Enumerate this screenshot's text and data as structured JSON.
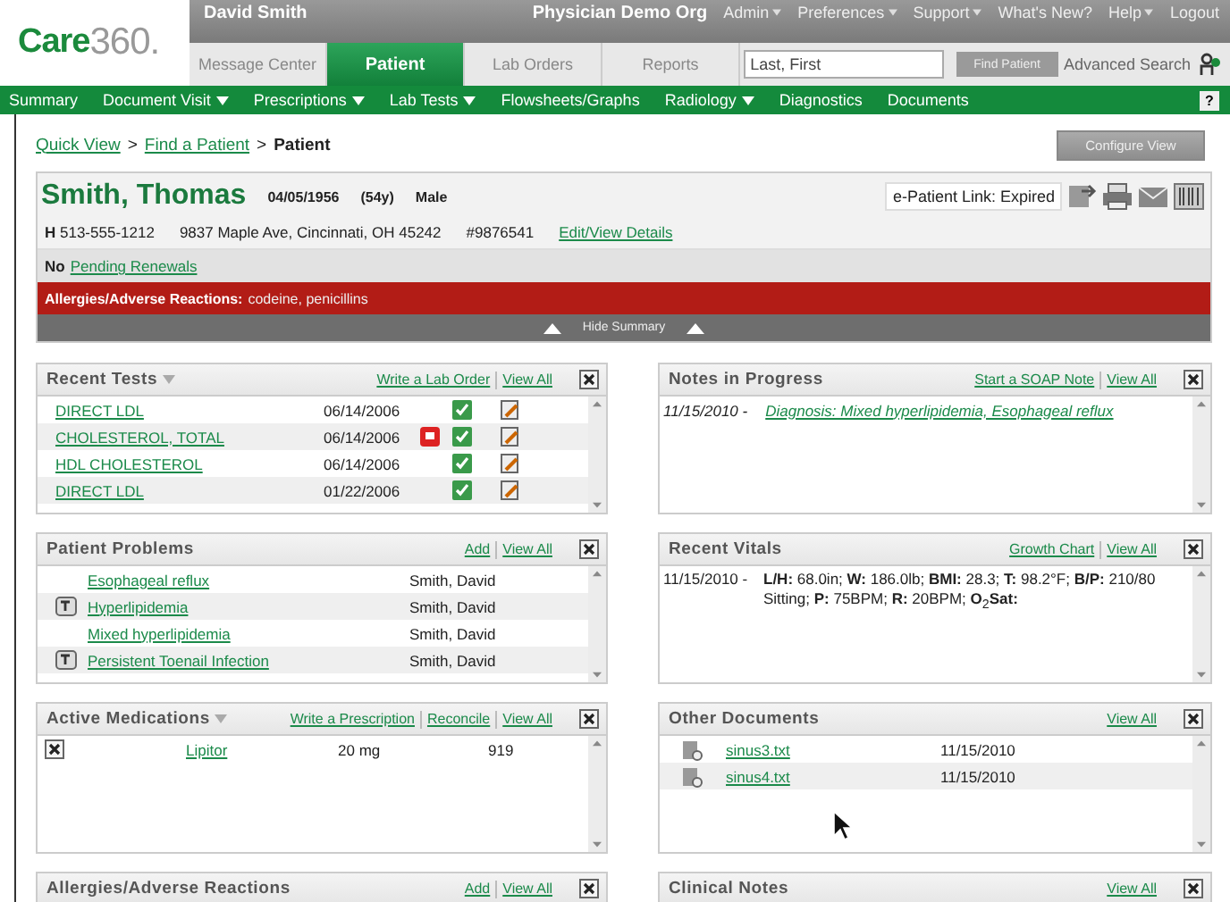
{
  "header": {
    "logo": {
      "brand": "Care",
      "suffix": "360."
    },
    "user": "David Smith",
    "org": "Physician Demo Org",
    "top_menu": [
      {
        "label": "Admin",
        "has_menu": true
      },
      {
        "label": "Preferences",
        "has_menu": true
      },
      {
        "label": "Support",
        "has_menu": true
      },
      {
        "label": "What's New?",
        "has_menu": false
      },
      {
        "label": "Help",
        "has_menu": true
      },
      {
        "label": "Logout",
        "has_menu": false
      }
    ],
    "tabs": [
      {
        "label": "Message Center",
        "selected": false
      },
      {
        "label": "Patient",
        "selected": true
      },
      {
        "label": "Lab Orders",
        "selected": false
      },
      {
        "label": "Reports",
        "selected": false
      }
    ],
    "search": {
      "placeholder": "Last, First",
      "button": "Find Patient",
      "advanced": "Advanced Search"
    }
  },
  "nav": [
    {
      "label": "Summary",
      "has_menu": false
    },
    {
      "label": "Document Visit",
      "has_menu": true
    },
    {
      "label": "Prescriptions",
      "has_menu": true
    },
    {
      "label": "Lab Tests",
      "has_menu": true
    },
    {
      "label": "Flowsheets/Graphs",
      "has_menu": false
    },
    {
      "label": "Radiology",
      "has_menu": true
    },
    {
      "label": "Diagnostics",
      "has_menu": false
    },
    {
      "label": "Documents",
      "has_menu": false
    }
  ],
  "nav_help": "?",
  "breadcrumb": [
    {
      "label": "Quick View",
      "link": true
    },
    {
      "label": "Find a Patient",
      "link": true
    },
    {
      "label": "Patient",
      "link": false
    }
  ],
  "breadcrumb_sep": ">",
  "configure_button": "Configure View",
  "patient": {
    "name": "Smith, Thomas",
    "dob": "04/05/1956",
    "age": "(54y)",
    "sex": "Male",
    "epatient_link": "e-Patient Link: Expired",
    "phone": "**H** 513-555-1212",
    "address": "9837 Maple Ave, Cincinnati, OH 45242",
    "id": "#9876541",
    "edit_link": "Edit/View Details",
    "renewals_prefix": "No",
    "renewals_link": "Pending Renewals",
    "allergies": "**Allergies/Adverse Reactions:** codeine, penicillins",
    "hide_summary": "Hide Summary"
  },
  "left_panels": [
    {
      "kind": "tests",
      "title": "Recent Tests",
      "has_menu": true,
      "links": [
        "Write a Lab Order",
        "View All"
      ],
      "rows": [
        {
          "name": "DIRECT LDL",
          "date": "06/14/2006",
          "flagged": false
        },
        {
          "name": "CHOLESTEROL, TOTAL",
          "date": "06/14/2006",
          "flagged": true
        },
        {
          "name": "HDL CHOLESTEROL",
          "date": "06/14/2006",
          "flagged": false
        },
        {
          "name": "DIRECT LDL",
          "date": "01/22/2006",
          "flagged": false
        }
      ]
    },
    {
      "kind": "problems",
      "title": "Patient Problems",
      "has_menu": false,
      "links": [
        "Add",
        "View All"
      ],
      "rows": [
        {
          "name": "Esophageal reflux",
          "provider": "Smith, David",
          "note": false
        },
        {
          "name": "Hyperlipidemia",
          "provider": "Smith, David",
          "note": true
        },
        {
          "name": "Mixed hyperlipidemia",
          "provider": "Smith, David",
          "note": false
        },
        {
          "name": "Persistent Toenail Infection",
          "provider": "Smith, David",
          "note": true
        }
      ]
    },
    {
      "kind": "medications",
      "title": "Active Medications",
      "has_menu": true,
      "links": [
        "Write a Prescription",
        "Reconcile",
        "View All"
      ],
      "rows": [
        {
          "name": "Lipitor",
          "dose": "20 mg",
          "number": "919"
        }
      ]
    },
    {
      "kind": "empty",
      "title": "Allergies/Adverse Reactions",
      "has_menu": false,
      "links": [
        "Add",
        "View All"
      ]
    }
  ],
  "right_panels": [
    {
      "kind": "notes",
      "title": "Notes in Progress",
      "has_menu": false,
      "links": [
        "Start a SOAP Note",
        "View All"
      ],
      "rows": [
        {
          "date": "11/15/2010 -",
          "text": "Diagnosis: Mixed hyperlipidemia, Esophageal reflux"
        }
      ]
    },
    {
      "kind": "vitals",
      "title": "Recent Vitals",
      "has_menu": false,
      "links": [
        "Growth Chart",
        "View All"
      ],
      "rows": [
        {
          "date": "11/15/2010 -",
          "text": "**L/H:** 68.0in; **W:** 186.0lb; **BMI:** 28.3; **T:** 98.2°F; **B/P:** 210/80 Sitting; **P:** 75BPM; **R:** 20BPM; **O**$_{2}$**Sat:**"
        }
      ]
    },
    {
      "kind": "documents",
      "title": "Other Documents",
      "has_menu": false,
      "links": [
        "View All"
      ],
      "rows": [
        {
          "name": "sinus3.txt",
          "date": "11/15/2010"
        },
        {
          "name": "sinus4.txt",
          "date": "11/15/2010"
        }
      ]
    },
    {
      "kind": "empty",
      "title": "Clinical Notes",
      "has_menu": false,
      "links": [
        "View All"
      ]
    }
  ]
}
